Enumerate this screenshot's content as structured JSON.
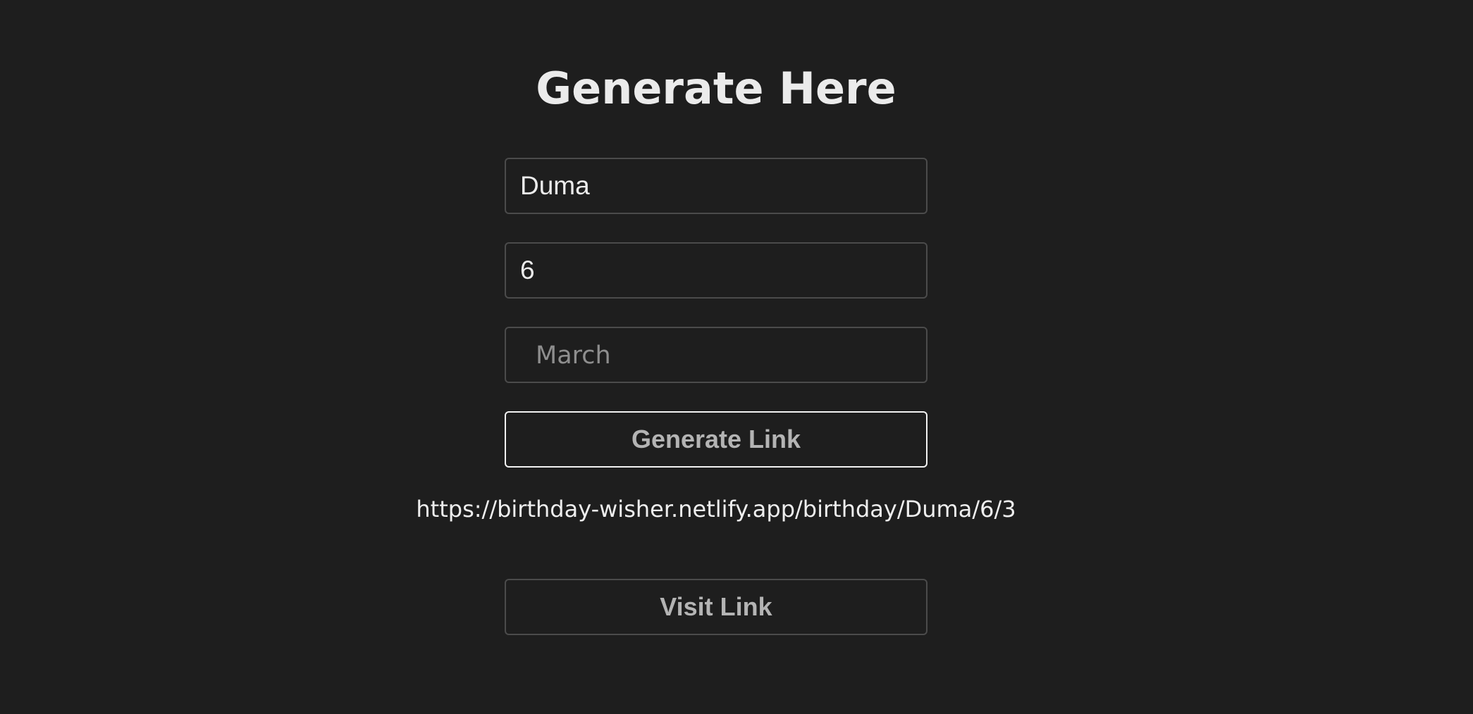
{
  "form": {
    "title": "Generate Here",
    "name_value": "Duma",
    "day_value": "6",
    "month_placeholder": "March",
    "month_value": "",
    "generate_label": "Generate Link",
    "generated_link": "https://birthday-wisher.netlify.app/birthday/Duma/6/3",
    "visit_label": "Visit Link"
  }
}
